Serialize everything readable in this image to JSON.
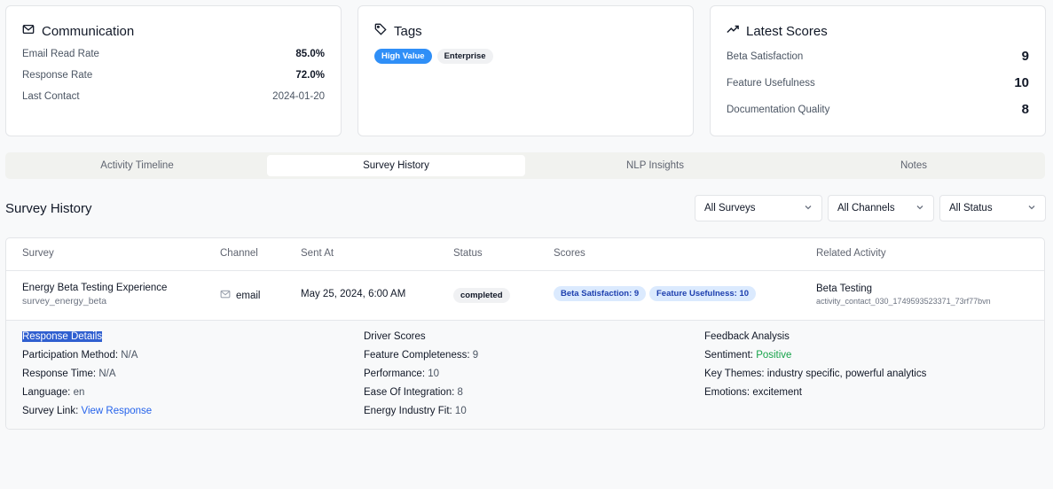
{
  "communication": {
    "title": "Communication",
    "icon": "mail-icon",
    "rows": [
      {
        "label": "Email Read Rate",
        "value": "85.0%"
      },
      {
        "label": "Response Rate",
        "value": "72.0%"
      },
      {
        "label": "Last Contact",
        "value": "2024-01-20"
      }
    ]
  },
  "tags": {
    "title": "Tags",
    "icon": "tag-icon",
    "items": [
      "High Value",
      "Enterprise"
    ]
  },
  "latest_scores": {
    "title": "Latest Scores",
    "icon": "trending-up-icon",
    "rows": [
      {
        "label": "Beta Satisfaction",
        "value": "9"
      },
      {
        "label": "Feature Usefulness",
        "value": "10"
      },
      {
        "label": "Documentation Quality",
        "value": "8"
      }
    ]
  },
  "tabs": [
    "Activity Timeline",
    "Survey History",
    "NLP Insights",
    "Notes"
  ],
  "active_tab": "Survey History",
  "section_title": "Survey History",
  "filters": [
    "All Surveys",
    "All Channels",
    "All Status"
  ],
  "table": {
    "headers": [
      "Survey",
      "Channel",
      "Sent At",
      "Status",
      "Scores",
      "Related Activity"
    ],
    "row": {
      "survey_name": "Energy Beta Testing Experience",
      "survey_id": "survey_energy_beta",
      "channel": "email",
      "sent_at": "May 25, 2024, 6:00 AM",
      "status": "completed",
      "scores": [
        "Beta Satisfaction: 9",
        "Feature Usefulness: 10"
      ],
      "related_title": "Beta Testing",
      "related_id": "activity_contact_030_1749593523371_73rf77bvn"
    }
  },
  "details": {
    "response": {
      "title": "Response Details",
      "participation_label": "Participation Method:",
      "participation_value": "N/A",
      "response_time_label": "Response Time:",
      "response_time_value": "N/A",
      "language_label": "Language:",
      "language_value": "en",
      "survey_link_label": "Survey Link:",
      "survey_link_value": "View Response"
    },
    "drivers": {
      "title": "Driver Scores",
      "items": [
        {
          "label": "Feature Completeness:",
          "value": "9"
        },
        {
          "label": "Performance:",
          "value": "10"
        },
        {
          "label": "Ease Of Integration:",
          "value": "8"
        },
        {
          "label": "Energy Industry Fit:",
          "value": "10"
        }
      ]
    },
    "feedback": {
      "title": "Feedback Analysis",
      "sentiment_label": "Sentiment:",
      "sentiment_value": "Positive",
      "themes_label": "Key Themes:",
      "themes_value": "industry specific, powerful analytics",
      "emotions_label": "Emotions:",
      "emotions_value": "excitement"
    }
  },
  "colors": {
    "accent": "#2f8ff7",
    "positive": "#16a34a",
    "link": "#2563eb",
    "score_pill_bg": "#dbeafe"
  }
}
